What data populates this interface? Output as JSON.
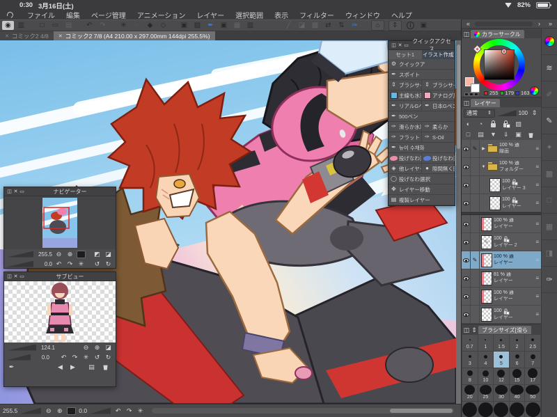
{
  "status_bar": {
    "time": "0:30",
    "date": "3月16日(土)",
    "battery_percent": "82%"
  },
  "menu_bar": {
    "items": [
      "ファイル",
      "編集",
      "ページ管理",
      "アニメーション",
      "レイヤー",
      "選択範囲",
      "表示",
      "フィルター",
      "ウィンドウ",
      "ヘルプ"
    ]
  },
  "toolbar": {
    "buttons": [
      {
        "name": "clip-studio-logo",
        "glyph": "◉",
        "active": true
      },
      {
        "name": "screen-layout",
        "glyph": "▥"
      },
      {
        "gap": true
      },
      {
        "name": "new-canvas",
        "glyph": "□"
      },
      {
        "name": "open-file",
        "glyph": "▭"
      },
      {
        "name": "save-file",
        "glyph": "▤",
        "disabled": true
      },
      {
        "gap": true
      },
      {
        "name": "undo",
        "glyph": "↶"
      },
      {
        "name": "redo",
        "glyph": "↷",
        "disabled": true
      },
      {
        "gap": true
      },
      {
        "name": "snap-ruler",
        "glyph": "✳"
      },
      {
        "name": "snap-special-ruler",
        "glyph": "◌",
        "disabled": true
      },
      {
        "name": "snap-grid",
        "glyph": "◆"
      },
      {
        "name": "transform",
        "glyph": "◇"
      },
      {
        "gap": true
      },
      {
        "name": "window-panel-a",
        "glyph": "▣"
      },
      {
        "name": "window-panel-b",
        "glyph": "▨"
      },
      {
        "name": "modifier-settings",
        "glyph": "✒",
        "accent": true
      },
      {
        "name": "window-panel-c",
        "glyph": "▣"
      },
      {
        "name": "grid-toggle",
        "glyph": "▦",
        "disabled": true
      },
      {
        "name": "capture",
        "glyph": "▥"
      },
      {
        "gap": true,
        "wide": true
      },
      {
        "name": "pen-pressure",
        "glyph": "╱",
        "disabled": true
      },
      {
        "name": "mask-view",
        "glyph": "◪",
        "disabled": true
      },
      {
        "name": "selection-view",
        "glyph": "▩",
        "disabled": true
      },
      {
        "name": "flip-horizontal",
        "glyph": "⇄"
      },
      {
        "name": "flip-vertical",
        "glyph": "⇅"
      },
      {
        "name": "quick-brush",
        "glyph": "✑",
        "accent": true
      },
      {
        "gap": true
      },
      {
        "name": "window-collapse",
        "glyph": "⌂",
        "boxed": true
      },
      {
        "name": "panel-updown",
        "glyph": "⇕",
        "boxed": true
      },
      {
        "name": "info",
        "glyph": "i",
        "circle": true
      },
      {
        "name": "duplicate-window",
        "glyph": "▣"
      }
    ]
  },
  "tab_bar": {
    "tabs": [
      {
        "label": "コミック2 4/8",
        "active": false
      },
      {
        "label": "コミック2 7/8 (A4 210.00 x 297.00mm 144dpi 255.5%)",
        "active": true
      }
    ]
  },
  "quick_access": {
    "title": "クイックアクセス",
    "tabs": [
      {
        "label": "セット1",
        "active": false
      },
      {
        "label": "イラスト作成",
        "active": true
      }
    ],
    "rows": [
      [
        {
          "label": "クイックア",
          "icon": "gear"
        }
      ],
      [
        {
          "label": "スポイト",
          "icon": "dropper"
        }
      ],
      [
        {
          "label": "ブラシサイズ",
          "icon": "stepper-ud"
        },
        {
          "label": "ブラシサイズ",
          "icon": "stepper-ud"
        }
      ],
      [
        {
          "label": "主線も水彩も",
          "icon": "swatch-blue"
        },
        {
          "label": "アナログ風G",
          "icon": "swatch-pink"
        }
      ],
      [
        {
          "label": "リアルGペン",
          "icon": "pen"
        },
        {
          "label": "日本Gペン",
          "icon": "pen"
        }
      ],
      [
        {
          "label": "500ペン",
          "icon": "pen"
        }
      ],
      [
        {
          "label": "滑らか水彩",
          "icon": "brush"
        },
        {
          "label": "柔らか",
          "icon": "brush"
        }
      ],
      [
        {
          "label": "フラット",
          "icon": "brush"
        },
        {
          "label": "S-Oil",
          "icon": "brush"
        }
      ],
      [
        {
          "label": "뉴이 수채화",
          "icon": "pen"
        }
      ],
      [
        {
          "label": "投げなわ塗り",
          "icon": "lasso-pink"
        },
        {
          "label": "投げなわ塗り",
          "icon": "lasso-blue"
        }
      ],
      [
        {
          "label": "他レイヤーを",
          "icon": "bucket"
        },
        {
          "label": "隙間無く囲っ",
          "icon": "enclose"
        }
      ],
      [
        {
          "label": "投げなわ選択",
          "icon": "lasso"
        }
      ],
      [
        {
          "label": "レイヤー移動",
          "icon": "move"
        }
      ],
      [
        {
          "label": "複製レイヤー",
          "icon": "dup"
        }
      ]
    ]
  },
  "navigator": {
    "title": "ナビゲーター",
    "zoom_value": "255.5",
    "rotate_value": "0.0"
  },
  "subview": {
    "title": "サブビュー",
    "zoom_value": "124.1",
    "rotate_value": "0.0"
  },
  "color_panel": {
    "title": "カラーサークル",
    "r": "255",
    "g": "179",
    "b": "163",
    "current_color": "#FFB3A3",
    "red_chip": "#c03030",
    "green_chip": "#30a030",
    "blue_chip": "#3040c0"
  },
  "layers_panel": {
    "title": "レイヤー",
    "blend_mode": "通常",
    "opacity": "100",
    "layers": [
      {
        "eye": true,
        "target": true,
        "expand": "closed",
        "thumb": "folder",
        "info": "100 % 通",
        "name": "線画",
        "indent": 0
      },
      {
        "eye": true,
        "expand": "open",
        "thumb": "folder",
        "info": "100 % 通",
        "name": "フォルダー",
        "indent": 0
      },
      {
        "eye": true,
        "thumb": "checker",
        "info": "100",
        "lock": true,
        "name": "レイヤー 3",
        "indent": 1
      },
      {
        "eye": true,
        "thumb": "checker",
        "info": "100",
        "lock": true,
        "name": "レイヤー",
        "indent": 1,
        "divider": true
      },
      {
        "eye": true,
        "thumb": "checker",
        "tag": true,
        "info": "100 % 通",
        "name": "レイヤー",
        "indent": 0
      },
      {
        "eye": true,
        "thumb": "sketch",
        "info": "100",
        "lock": true,
        "name": "レイヤー 2",
        "indent": 0
      },
      {
        "eye": true,
        "target": true,
        "selected": true,
        "thumb": "checker",
        "tag": true,
        "info": "100 % 通",
        "name": "レイヤー",
        "indent": 0
      },
      {
        "eye": true,
        "thumb": "checker",
        "tag": true,
        "info": "81 % 通",
        "name": "レイヤー",
        "indent": 0
      },
      {
        "eye": true,
        "thumb": "checker",
        "tag": true,
        "info": "100 % 通",
        "name": "レイヤー",
        "indent": 0
      },
      {
        "eye": true,
        "thumb": "checker",
        "info": "100",
        "lock": true,
        "name": "レイヤー",
        "indent": 0
      }
    ]
  },
  "brush_panel": {
    "title": "ブラシサイズ[滑ら",
    "rows": [
      [
        {
          "l": "0.7",
          "d": 2
        },
        {
          "l": "1",
          "d": 2
        },
        {
          "l": "1.5",
          "d": 3
        },
        {
          "l": "2",
          "d": 3
        },
        {
          "l": "2.5",
          "d": 4
        }
      ],
      [
        {
          "l": "3",
          "d": 4
        },
        {
          "l": "4",
          "d": 5
        },
        {
          "l": "5",
          "d": 5,
          "sel": true
        },
        {
          "l": "6",
          "d": 6
        },
        {
          "l": "7",
          "d": 7
        }
      ],
      [
        {
          "l": "8",
          "d": 8
        },
        {
          "l": "10",
          "d": 9
        },
        {
          "l": "12",
          "d": 11
        },
        {
          "l": "15",
          "d": 13
        },
        {
          "l": "17",
          "d": 14
        }
      ],
      [
        {
          "l": "20",
          "d": 15
        },
        {
          "l": "25",
          "d": 17
        },
        {
          "l": "30",
          "d": 18
        },
        {
          "l": "40",
          "d": 19
        },
        {
          "l": "50",
          "d": 20
        }
      ],
      [
        {
          "l": "",
          "d": 21
        },
        {
          "l": "",
          "d": 21
        },
        {
          "l": "",
          "d": 21
        },
        {
          "l": "",
          "d": 21
        },
        {
          "l": "",
          "d": 21
        }
      ]
    ]
  },
  "canvas_status": {
    "zoom_value": "255.5",
    "rotate_value": "0.0"
  },
  "dock": {
    "palette_tabs": [
      {
        "name": "color-wheel",
        "glyph": "#wheel"
      },
      {
        "name": "approx-color",
        "glyph": "≋"
      },
      {
        "name": "color-mixing",
        "glyph": "✐",
        "disabled": true
      },
      {
        "name": "color-set",
        "glyph": "✎"
      },
      {
        "name": "auto-action",
        "glyph": "✦",
        "disabled": true
      },
      {
        "name": "material",
        "glyph": "▩",
        "disabled": true
      },
      {
        "name": "canvas-frame",
        "glyph": "□",
        "disabled": true
      },
      {
        "name": "timeline",
        "glyph": "▦",
        "disabled": true
      },
      {
        "name": "layer-property",
        "glyph": "◨",
        "disabled": true
      },
      {
        "name": "brush-size",
        "glyph": "✑"
      }
    ]
  },
  "icon_glyphs": {
    "window-menu": "◫",
    "close": "✕",
    "collapse": "▭",
    "zoom-out": "⊖",
    "zoom-in": "⊕",
    "fit-view": "▪",
    "flip-h": "◩",
    "flip-v": "◪",
    "rotate-left": "↶",
    "rotate-right": "↷",
    "reset-rotation": "✳",
    "rotate-ccw": "↺",
    "rotate-cw": "↻",
    "prev": "◀",
    "next": "▶",
    "eyedropper": "✒",
    "open-file": "▤",
    "delete": "#trash",
    "chevron-left-double": "«",
    "chevron-right": "›",
    "chevron-right-double": "»",
    "mask-area": "◐",
    "clip-mask": "◔",
    "lock": "#lock",
    "lock-alpha": "#lockalpha",
    "light-table": "▨",
    "new-layer": "□",
    "new-folder": "▤",
    "transfer-down": "▼",
    "merge-down": "⇓",
    "layer-camera": "▣",
    "trash": "#trash",
    "gear": "⚙",
    "dropper": "✒",
    "pen": "✒",
    "brush": "✑",
    "stepper-ud": "⇕",
    "bucket": "◈",
    "enclose": "●",
    "lasso": "◯",
    "move": "✥",
    "dup": "▤",
    "swatch-blue": "#swblue",
    "swatch-pink": "#swpink",
    "lasso-pink": "#lspink",
    "lasso-blue": "#lsblue",
    "expand-closed": "▶",
    "expand-open": "▼",
    "row-menu": "≡",
    "stepper": "⇕",
    "pen-target": "✎"
  }
}
